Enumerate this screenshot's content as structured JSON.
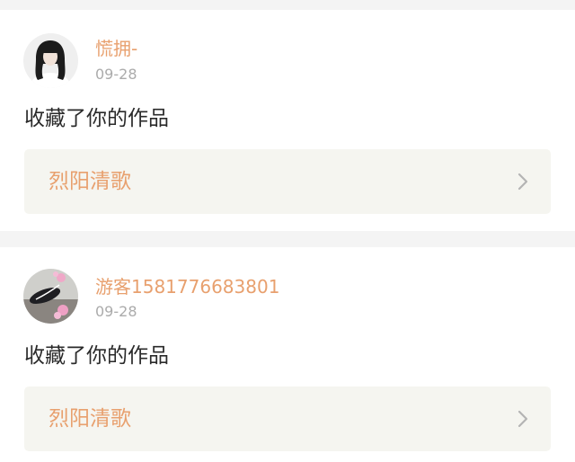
{
  "feed": {
    "items": [
      {
        "username": "慌拥-",
        "date": "09-28",
        "action": "收藏了你的作品",
        "work_title": "烈阳清歌",
        "avatar_icon": "user-photo-girl",
        "chevron_icon": "chevron-right-icon"
      },
      {
        "username": "游客1581776683801",
        "date": "09-28",
        "action": "收藏了你的作品",
        "work_title": "烈阳清歌",
        "avatar_icon": "user-photo-flowers",
        "chevron_icon": "chevron-right-icon"
      }
    ]
  },
  "colors": {
    "accent": "#e8a06e",
    "date": "#ababab",
    "text": "#2a2a2a",
    "card_bg": "#ffffff",
    "page_bg": "#f4f4f4",
    "work_bg": "#f5f5f0"
  }
}
